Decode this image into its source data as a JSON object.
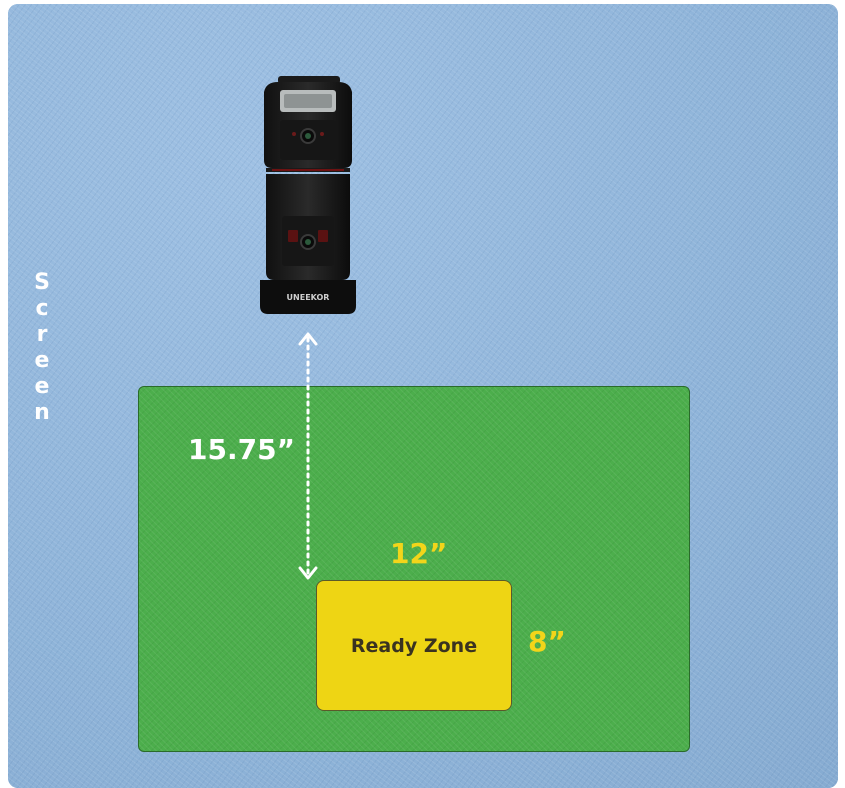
{
  "screen_label": "Screen",
  "device": {
    "brand": "UNEEKOR"
  },
  "measurements": {
    "distance": "15.75”",
    "zone_width": "12”",
    "zone_height": "8”"
  },
  "ready_zone": {
    "label": "Ready Zone"
  },
  "colors": {
    "background_turf": "#8fb4d9",
    "hitting_mat": "#4cae4c",
    "ready_zone": "#eed514",
    "dimension_accent": "#f2d51a",
    "dimension_white": "#ffffff"
  }
}
